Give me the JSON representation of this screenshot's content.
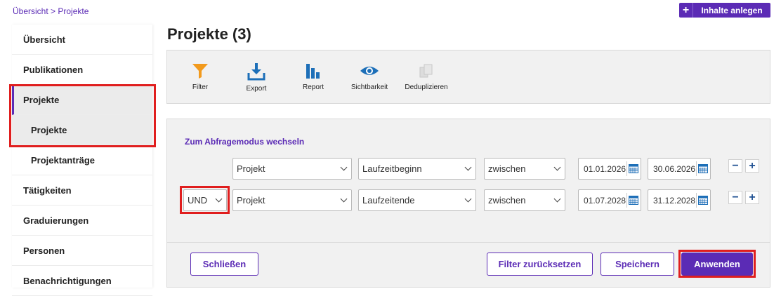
{
  "breadcrumb": {
    "home": "Übersicht",
    "separator": " > ",
    "current": "Projekte"
  },
  "header": {
    "create_plus": "+",
    "create_label": "Inhalte anlegen"
  },
  "page": {
    "title": "Projekte (3)"
  },
  "sidebar": {
    "items": [
      {
        "label": "Übersicht"
      },
      {
        "label": "Publikationen"
      },
      {
        "label": "Projekte"
      },
      {
        "label": "Projekte"
      },
      {
        "label": "Projektanträge"
      },
      {
        "label": "Tätigkeiten"
      },
      {
        "label": "Graduierungen"
      },
      {
        "label": "Personen"
      },
      {
        "label": "Benachrichtigungen"
      }
    ]
  },
  "toolbar": {
    "filter": "Filter",
    "export": "Export",
    "report": "Report",
    "visibility": "Sichtbarkeit",
    "dedupe": "Deduplizieren"
  },
  "filter_panel": {
    "query_mode_link": "Zum Abfragemodus wechseln",
    "rows": [
      {
        "field": "Projekt",
        "attribute": "Laufzeitbeginn",
        "operator": "zwischen",
        "from": "01.01.2026",
        "to": "30.06.2026"
      },
      {
        "logic": "UND",
        "field": "Projekt",
        "attribute": "Laufzeitende",
        "operator": "zwischen",
        "from": "01.07.2028",
        "to": "31.12.2028"
      }
    ],
    "minus": "−",
    "plus": "+"
  },
  "actions": {
    "close": "Schließen",
    "reset": "Filter zurücksetzen",
    "save": "Speichern",
    "apply": "Anwenden"
  },
  "colors": {
    "accent": "#5b2bb5",
    "highlight": "#e01e1e",
    "filter_icon": "#f29a1d",
    "icon_blue": "#1d6fb8"
  },
  "icons": {
    "filter": "funnel-icon",
    "export": "download-icon",
    "report": "bar-chart-icon",
    "visibility": "eye-icon",
    "dedupe": "duplicate-icon",
    "calendar": "calendar-icon"
  }
}
